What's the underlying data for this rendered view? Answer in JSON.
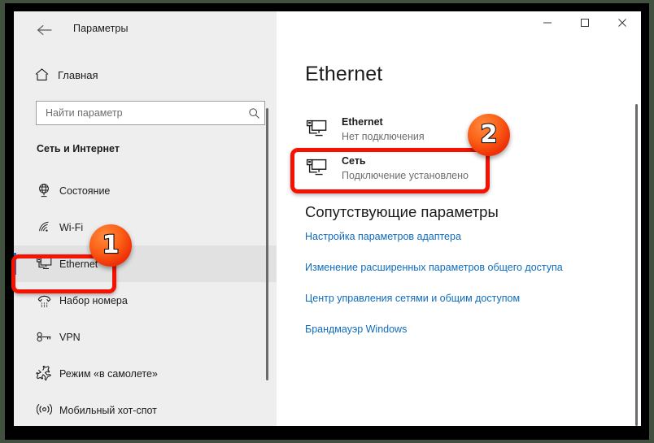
{
  "window": {
    "title": "Параметры",
    "back_icon": "back-arrow-icon",
    "controls": {
      "minimize": "minimize-icon",
      "maximize": "maximize-icon",
      "close": "close-icon"
    }
  },
  "sidebar": {
    "home": {
      "label": "Главная",
      "icon": "home-icon"
    },
    "search": {
      "placeholder": "Найти параметр",
      "value": "",
      "icon": "search-icon"
    },
    "section_title": "Сеть и Интернет",
    "items": [
      {
        "label": "Состояние",
        "icon": "globe-network-icon",
        "selected": false
      },
      {
        "label": "Wi-Fi",
        "icon": "wifi-icon",
        "selected": false
      },
      {
        "label": "Ethernet",
        "icon": "ethernet-monitor-icon",
        "selected": true
      },
      {
        "label": "Набор номера",
        "icon": "dialup-phone-icon",
        "selected": false
      },
      {
        "label": "VPN",
        "icon": "vpn-key-icon",
        "selected": false
      },
      {
        "label": "Режим «в самолете»",
        "icon": "airplane-icon",
        "selected": false
      },
      {
        "label": "Мобильный хот-спот",
        "icon": "hotspot-icon",
        "selected": false
      }
    ]
  },
  "content": {
    "page_title": "Ethernet",
    "adapters": [
      {
        "name": "Ethernet",
        "state": "Нет подключения",
        "icon": "ethernet-monitor-icon"
      },
      {
        "name": "Сеть",
        "state": "Подключение установлено",
        "icon": "ethernet-monitor-icon"
      }
    ],
    "related": {
      "title": "Сопутствующие параметры",
      "links": [
        "Настройка параметров адаптера",
        "Изменение расширенных параметров общего доступа",
        "Центр управления сетями и общим доступом",
        "Брандмауэр Windows"
      ]
    }
  },
  "annotations": {
    "badges": [
      {
        "number": "1",
        "target": "sidebar-item-ethernet"
      },
      {
        "number": "2",
        "target": "adapter-set"
      }
    ],
    "highlight_color": "#f61100"
  },
  "colors": {
    "sidebar_bg": "#eeeeee",
    "content_bg": "#ffffff",
    "link": "#0f6cbd",
    "accent": "#0078d7",
    "annotation": "#f61100",
    "frame": "#000000",
    "desktop": "#41503f"
  }
}
